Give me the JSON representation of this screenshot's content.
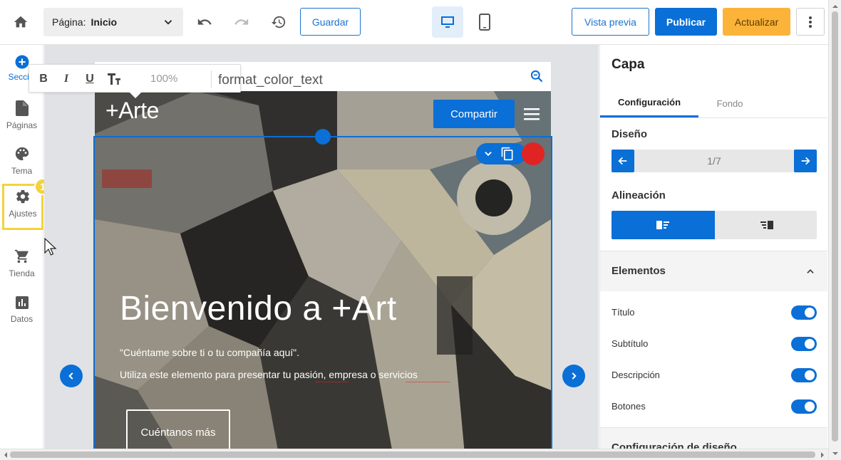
{
  "topbar": {
    "page_label": "Página:",
    "page_value": "Inicio",
    "save_label": "Guardar",
    "preview_label": "Vista previa",
    "publish_label": "Publicar",
    "update_label": "Actualizar"
  },
  "sidebar": {
    "items": [
      {
        "label": "Secciones",
        "icon": "add-circle-icon"
      },
      {
        "label": "Páginas",
        "icon": "page-icon"
      },
      {
        "label": "Tema",
        "icon": "palette-icon"
      },
      {
        "label": "Ajustes",
        "icon": "gear-icon"
      },
      {
        "label": "Tienda",
        "icon": "cart-icon"
      },
      {
        "label": "Datos",
        "icon": "chart-icon"
      }
    ],
    "badge": "1"
  },
  "text_toolbar": {
    "bold": "B",
    "italic": "I",
    "underline": "U",
    "size_value": "100%",
    "color_icon_text": "format_color_text"
  },
  "site": {
    "logo": "+Arte",
    "share_label": "Compartir",
    "hero_title": "Bienvenido a +Art",
    "hero_subtitle": "\"Cuéntame sobre ti o tu compañía aquí\".",
    "hero_description": "Utiliza este elemento para presentar tu pasión, empresa o servicios",
    "hero_button": "Cuéntanos más"
  },
  "panel": {
    "title": "Capa",
    "tabs": [
      "Configuración",
      "Fondo"
    ],
    "design_label": "Diseño",
    "design_counter": "1/7",
    "alignment_label": "Alineación",
    "elements_label": "Elementos",
    "elements": [
      {
        "label": "Título",
        "on": true
      },
      {
        "label": "Subtítulo",
        "on": true
      },
      {
        "label": "Descripción",
        "on": true
      },
      {
        "label": "Botones",
        "on": true
      }
    ],
    "next_section": "Configuración de diseño"
  },
  "colors": {
    "accent": "#0a6fd6",
    "update_button": "#fbb339",
    "highlight_yellow": "#f2d33c",
    "red_dot": "#e02424"
  }
}
